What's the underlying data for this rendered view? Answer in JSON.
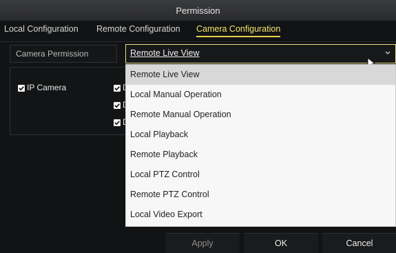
{
  "dialog": {
    "title": "Permission",
    "tabs": [
      {
        "label": "Local Configuration"
      },
      {
        "label": "Remote Configuration"
      },
      {
        "label": "Camera Configuration"
      }
    ],
    "selected_tab": "Camera Configuration",
    "camera_permission_label": "Camera Permission",
    "select": {
      "selected_value": "Remote Live View"
    },
    "panel": {
      "ip_camera_label": "IP Camera",
      "channel_checkboxes": [
        {
          "label": "D",
          "checked": true
        },
        {
          "label": "D",
          "checked": true
        },
        {
          "label": "D",
          "checked": true
        }
      ]
    },
    "dropdown_options": [
      {
        "label": "Remote Live View",
        "selected": true
      },
      {
        "label": "Local Manual Operation",
        "selected": false
      },
      {
        "label": "Remote Manual Operation",
        "selected": false
      },
      {
        "label": "Local Playback",
        "selected": false
      },
      {
        "label": "Remote Playback",
        "selected": false
      },
      {
        "label": "Local PTZ Control",
        "selected": false
      },
      {
        "label": "Remote PTZ Control",
        "selected": false
      },
      {
        "label": "Local Video Export",
        "selected": false
      }
    ],
    "buttons": {
      "apply": "Apply",
      "ok": "OK",
      "cancel": "Cancel"
    },
    "colors": {
      "accent_yellow": "#E6D24A",
      "dropdown_bg": "#F7F7F7",
      "selected_option_bg": "#D8D8D8",
      "dialog_bg": "#121314"
    },
    "icons": {
      "chevron": "chevron-down-icon",
      "checkbox": "checkbox-checked-icon",
      "cursor": "mouse-cursor-icon"
    }
  }
}
